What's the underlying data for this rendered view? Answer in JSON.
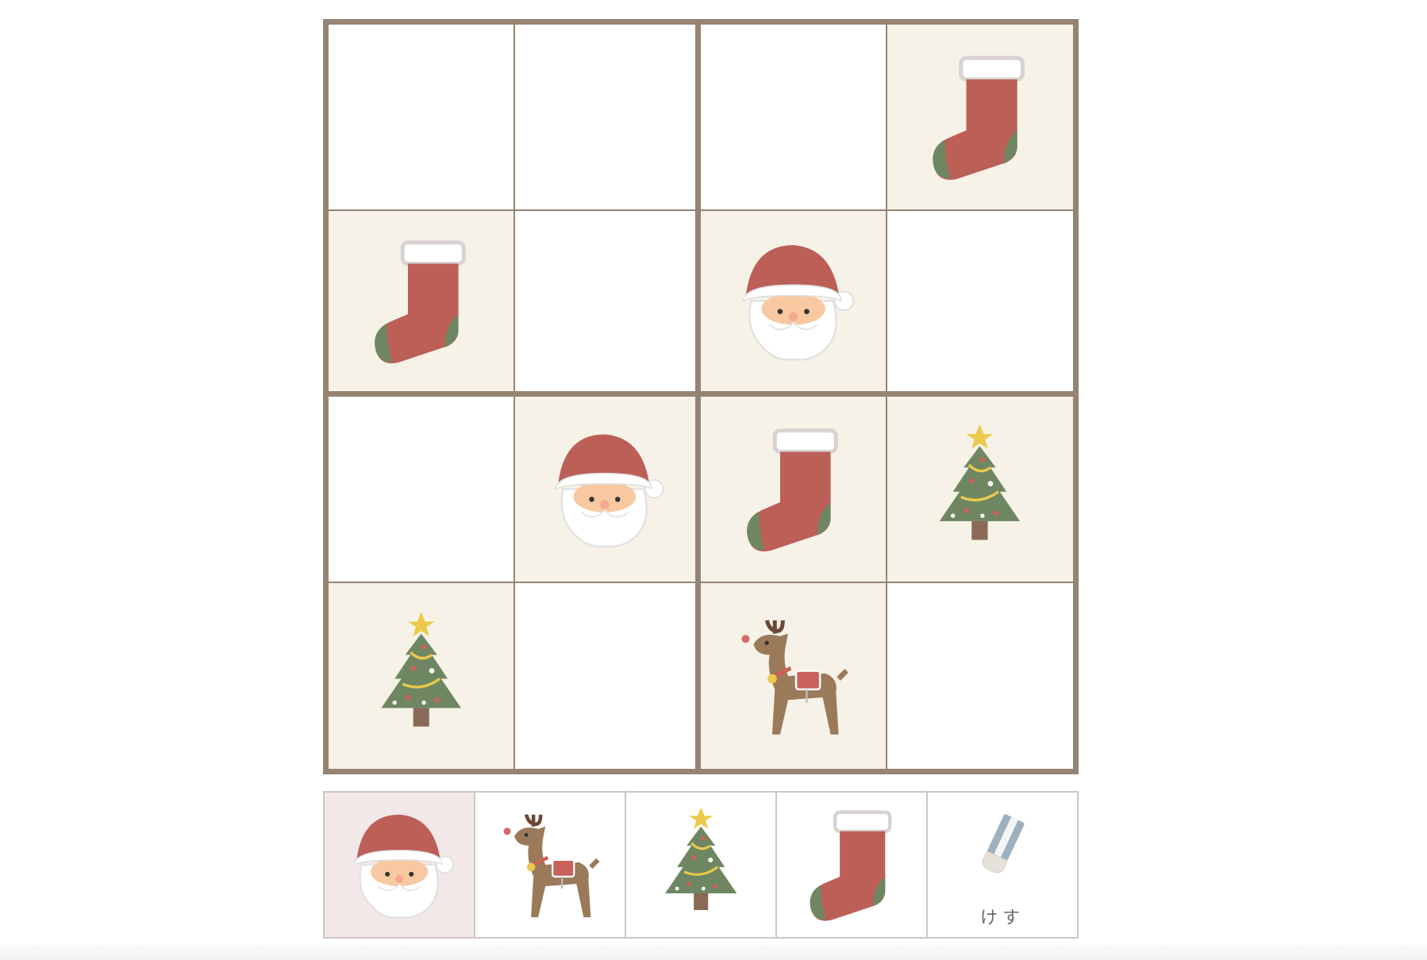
{
  "board": {
    "rows": [
      [
        "",
        "",
        "",
        "sock"
      ],
      [
        "sock",
        "",
        "santa",
        ""
      ],
      [
        "",
        "santa",
        "sock",
        "tree"
      ],
      [
        "tree",
        "",
        "reindeer",
        ""
      ]
    ],
    "given": [
      [
        false,
        false,
        false,
        true
      ],
      [
        true,
        false,
        true,
        false
      ],
      [
        false,
        true,
        true,
        true
      ],
      [
        true,
        false,
        true,
        false
      ]
    ]
  },
  "palette": {
    "items": [
      {
        "icon": "santa",
        "selected": true
      },
      {
        "icon": "reindeer",
        "selected": false
      },
      {
        "icon": "tree",
        "selected": false
      },
      {
        "icon": "sock",
        "selected": false
      },
      {
        "icon": "eraser",
        "selected": false,
        "label": "けす"
      }
    ]
  },
  "colors": {
    "board_border": "#958374",
    "given_cell": "#f6f2e7",
    "selected_palette": "#f2e8e8"
  }
}
